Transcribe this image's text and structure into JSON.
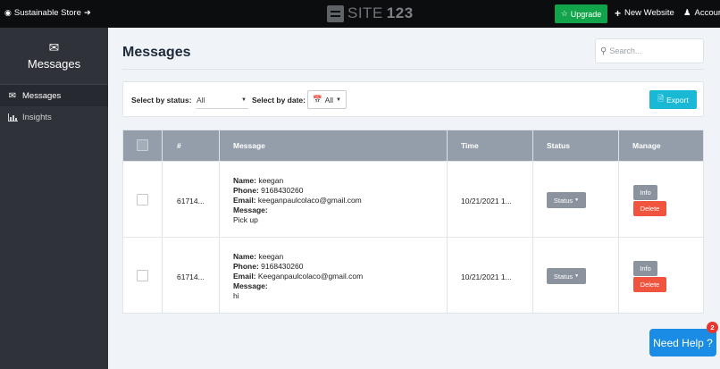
{
  "topbar": {
    "store_name": "Sustainable Store",
    "logo_text": "SITE",
    "logo_num": "123",
    "upgrade_label": "Upgrade",
    "new_website_label": "New Website",
    "account_label": "Account"
  },
  "sidebar": {
    "header": "Messages",
    "items": [
      {
        "label": "Messages",
        "icon": "envelope-icon",
        "active": true
      },
      {
        "label": "Insights",
        "icon": "bar-chart-icon",
        "active": false
      }
    ]
  },
  "page": {
    "title": "Messages",
    "search_placeholder": "Search..."
  },
  "filters": {
    "status_label": "Select by status:",
    "status_value": "All",
    "date_label": "Select by date:",
    "date_value": "All",
    "export_label": "Export"
  },
  "table": {
    "headers": {
      "id": "#",
      "message": "Message",
      "time": "Time",
      "status": "Status",
      "manage": "Manage"
    },
    "rows": [
      {
        "id": "61714...",
        "name_label": "Name:",
        "name": " keegan",
        "phone_label": "Phone:",
        "phone": " 9168430260",
        "email_label": "Email:",
        "email": " keeganpaulcolaco@gmail.com",
        "message_label": "Message:",
        "message": "Pick up",
        "time": "10/21/2021 1...",
        "status_btn": "Status",
        "info_btn": "Info",
        "delete_btn": "Delete"
      },
      {
        "id": "61714...",
        "name_label": "Name:",
        "name": " keegan",
        "phone_label": "Phone:",
        "phone": " 9168430260",
        "email_label": "Email:",
        "email": " Keeganpaulcolaco@gmail.com",
        "message_label": "Message:",
        "message": "hi",
        "time": "10/21/2021 1...",
        "status_btn": "Status",
        "info_btn": "Info",
        "delete_btn": "Delete"
      }
    ]
  },
  "help": {
    "label": "Need Help ?",
    "badge": "2"
  },
  "colors": {
    "topbar_bg": "#0b0d0f",
    "sidebar_bg": "#2f3238",
    "upgrade_green": "#12a44a",
    "export_cyan": "#19b9d6",
    "delete_red": "#f0533e",
    "help_blue": "#1a8ce6",
    "table_header": "#949eab"
  }
}
